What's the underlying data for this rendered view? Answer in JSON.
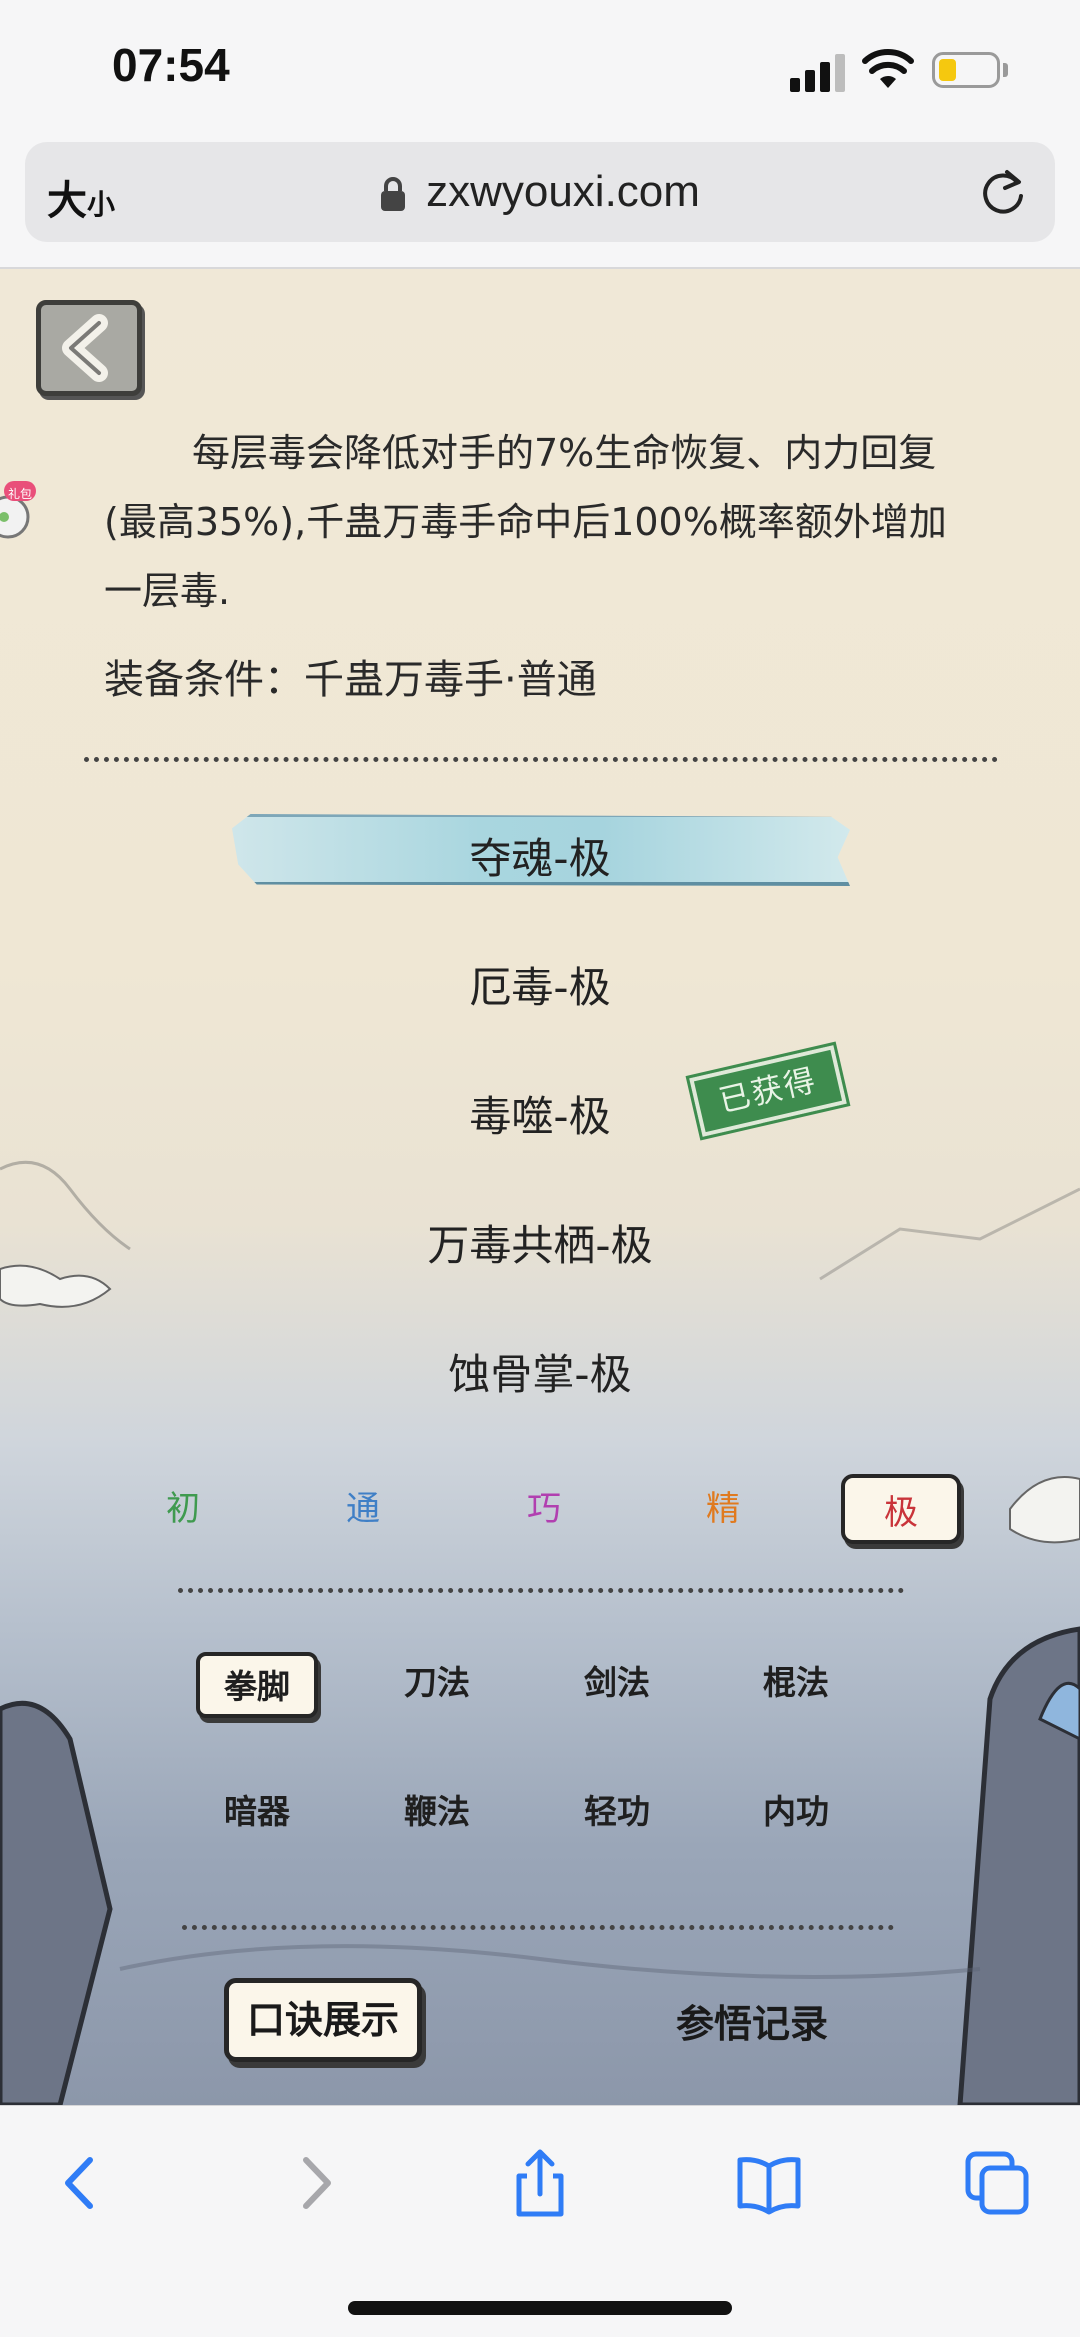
{
  "status_bar": {
    "time": "07:54",
    "battery_color": "#f5c80f"
  },
  "browser": {
    "text_size_big": "大",
    "text_size_small": "小",
    "url": "zxwyouxi.com"
  },
  "game": {
    "description": "每层毒会降低对手的7%生命恢复、内力回复(最高35%),千蛊万毒手命中后100%概率额外增加一层毒.",
    "equip_condition": "装备条件：千蛊万毒手·普通",
    "gift_badge": "礼包",
    "techniques": [
      {
        "name": "夺魂-极",
        "selected": true
      },
      {
        "name": "厄毒-极",
        "selected": false
      },
      {
        "name": "毒噬-极",
        "selected": false
      },
      {
        "name": "万毒共栖-极",
        "selected": false
      },
      {
        "name": "蚀骨掌-极",
        "selected": false
      }
    ],
    "obtained_stamp": "已获得",
    "grades": [
      {
        "label": "初",
        "color": "#3f9a4f"
      },
      {
        "label": "通",
        "color": "#3f7fc6"
      },
      {
        "label": "巧",
        "color": "#b13fb0"
      },
      {
        "label": "精",
        "color": "#e07a1f"
      },
      {
        "label": "极",
        "color": "#c9343a"
      }
    ],
    "categories": [
      "拳脚",
      "刀法",
      "剑法",
      "棍法",
      "暗器",
      "鞭法",
      "轻功",
      "内功"
    ],
    "koujue_button": "口诀展示",
    "canwu_link": "参悟记录"
  },
  "accent_color": "#2f7cf6"
}
